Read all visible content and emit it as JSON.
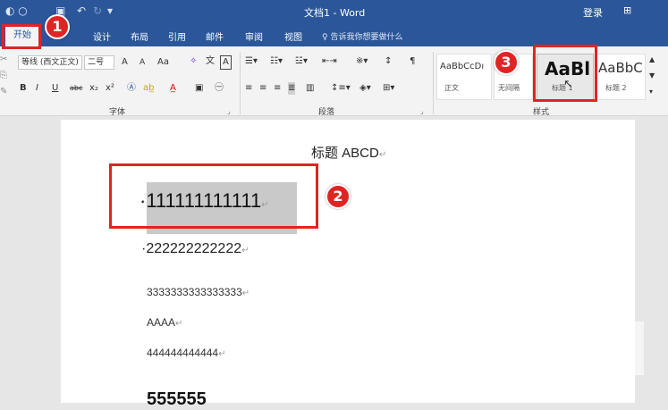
{
  "window": {
    "title": "文档1 - Word",
    "login": "登录",
    "restore_icon": "ribbon-display-icon",
    "close_icon": "close-icon"
  },
  "quick_access": {
    "undo_glyph": "↶",
    "redo_glyph": "↻",
    "customize_glyph": "▾"
  },
  "tabs": {
    "active": "开始",
    "items": [
      "设计",
      "布局",
      "引用",
      "邮件",
      "审阅",
      "视图"
    ],
    "tell_me": "告诉我你想要做什么"
  },
  "ribbon": {
    "font_name": "等线 (西文正文)",
    "font_size": "二号",
    "group_font": "字体",
    "group_paragraph": "段落",
    "group_styles": "样式",
    "style_normal_sample": "AaBbCcDı",
    "style_normal_name": "正文",
    "style_nospacing_name": "无间隔",
    "style_h1_sample": "AaBl",
    "style_h1_name": "标题 1",
    "style_h2_sample": "AaBbC",
    "style_h2_name": "标题 2",
    "font_buttons": [
      "A",
      "A",
      "Aa",
      "A"
    ],
    "format_buttons": [
      "B",
      "I",
      "U",
      "abc",
      "x₂",
      "x²"
    ]
  },
  "document": {
    "title_line": "标题 ABCD",
    "line1": "111111111111",
    "line2": "222222222222",
    "line3": "3333333333333333",
    "line4": "AAAA",
    "line5": "444444444444",
    "line6": "555555",
    "para_mark": "↵"
  },
  "annotations": {
    "step1": "1",
    "step2": "2",
    "step3": "3"
  },
  "colors": {
    "word_blue": "#2b579a",
    "annotation_red": "#e02424",
    "selection_gray": "#c9c9c9"
  }
}
